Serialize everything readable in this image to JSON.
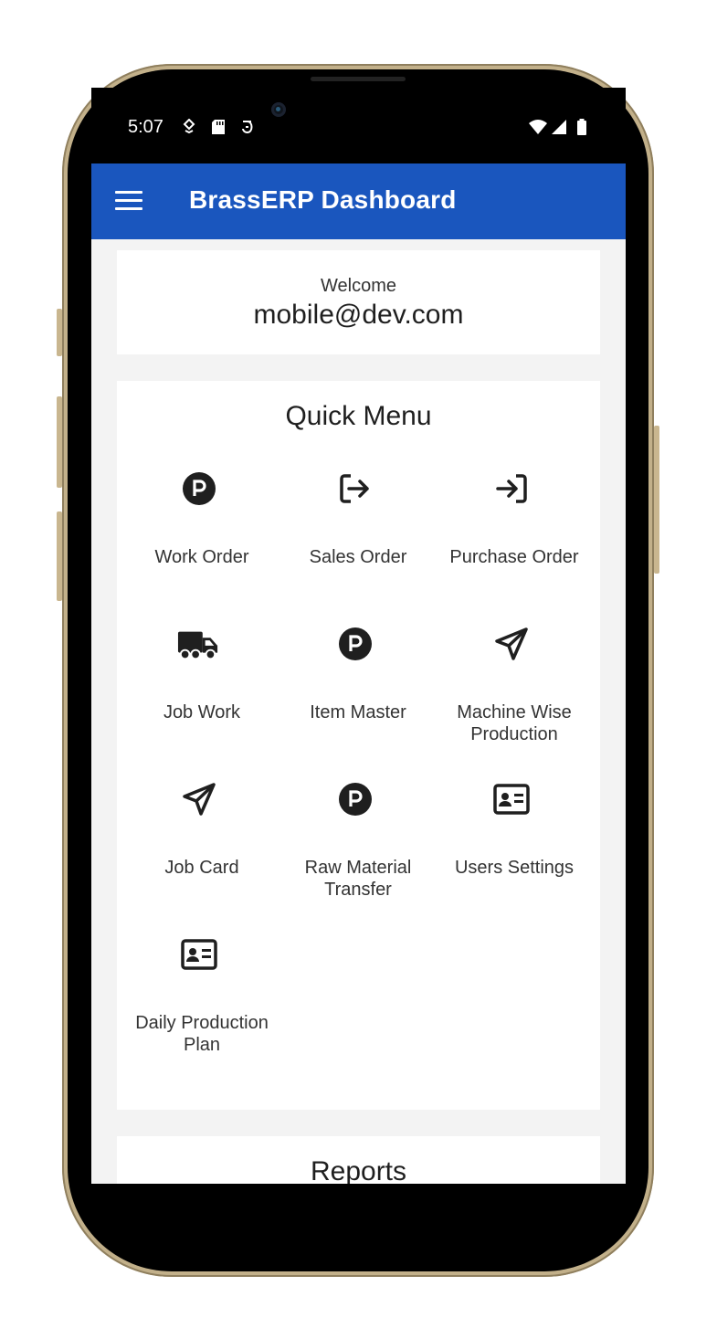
{
  "status_bar": {
    "time": "5:07"
  },
  "app_bar": {
    "title": "BrassERP Dashboard",
    "menu_icon": "hamburger-menu-icon"
  },
  "welcome": {
    "label": "Welcome",
    "email": "mobile@dev.com"
  },
  "quick_menu": {
    "title": "Quick Menu",
    "items": [
      {
        "label": "Work Order",
        "icon": "parking-circle-icon"
      },
      {
        "label": "Sales Order",
        "icon": "sign-out-icon"
      },
      {
        "label": "Purchase Order",
        "icon": "sign-in-icon"
      },
      {
        "label": "Job Work",
        "icon": "truck-icon"
      },
      {
        "label": "Item Master",
        "icon": "parking-circle-icon"
      },
      {
        "label": "Machine Wise Production",
        "icon": "paper-plane-icon"
      },
      {
        "label": "Job Card",
        "icon": "paper-plane-icon"
      },
      {
        "label": "Raw Material Transfer",
        "icon": "parking-circle-icon"
      },
      {
        "label": "Users Settings",
        "icon": "id-card-icon"
      },
      {
        "label": "Daily Production Plan",
        "icon": "id-card-icon"
      }
    ]
  },
  "reports": {
    "title": "Reports"
  },
  "colors": {
    "app_bar": "#1a56be",
    "background": "#f3f3f3",
    "card": "#ffffff"
  }
}
